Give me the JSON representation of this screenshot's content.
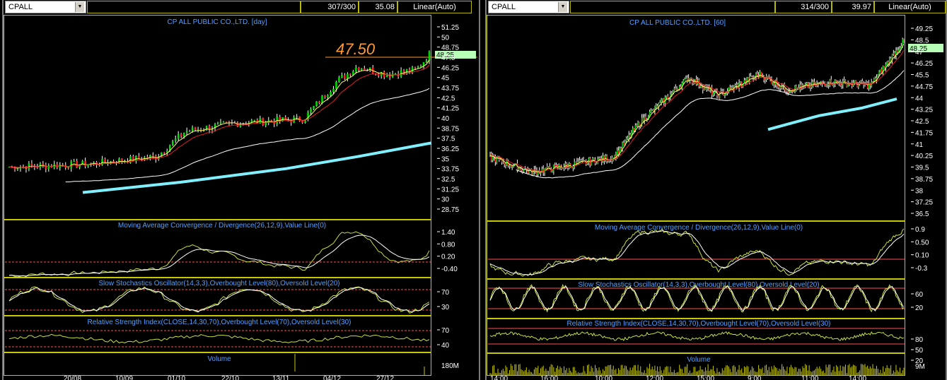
{
  "left": {
    "symbol": "CPALL",
    "counter": "307/300",
    "last_value": "35.08",
    "scale_mode": "Linear(Auto)",
    "title": "CP ALL PUBLIC CO.,LTD. [day]",
    "annotation": "47.50",
    "price_tag": "48.25",
    "price_ticks": [
      "51.25",
      "50",
      "48.75",
      "47.5",
      "46.25",
      "45",
      "43.75",
      "42.5",
      "41.25",
      "40",
      "38.75",
      "37.5",
      "36.25",
      "35",
      "33.75",
      "32.5",
      "31.25",
      "30",
      "28.75"
    ],
    "macd_title": "Moving Average Convergence / Divergence(26,12,9),Value Line(0)",
    "macd_ticks": [
      "1.40",
      "0.80",
      "0.20",
      "-0.40"
    ],
    "stoch_title": "Slow Stochastics Oscillator(14,3,3),Overbought Level(80),Oversold Level(20)",
    "stoch_ticks": [
      "70",
      "30"
    ],
    "rsi_title": "Relative Strength Index(CLOSE,14,30,70),Overbought Level(70),Oversold Level(30)",
    "rsi_ticks": [
      "70",
      "40"
    ],
    "volume_title": "Volume",
    "volume_tick": "180M",
    "date_labels": [
      "20/08",
      "10/09",
      "01/10",
      "22/10",
      "13/11",
      "04/12",
      "27/12"
    ]
  },
  "right": {
    "symbol": "CPALL",
    "counter": "314/300",
    "last_value": "39.97",
    "scale_mode": "Linear(Auto)",
    "title": "CP ALL PUBLIC CO.,LTD. [60]",
    "price_tag": "48.25",
    "price_ticks": [
      "49.25",
      "48.5",
      "47",
      "46.25",
      "45.5",
      "44.75",
      "44",
      "43.25",
      "42.5",
      "41.75",
      "41",
      "40.25",
      "39.5",
      "38.75",
      "38",
      "37.25",
      "36.5"
    ],
    "macd_title": "Moving Average Convergence / Divergence(26,12,9),Value Line(0)",
    "macd_ticks": [
      "0.9",
      "0.50",
      "0.10",
      "-0.3"
    ],
    "stoch_title": "Slow Stochastics Oscillator(14,3,3),Overbought Level(80),Oversold Level(20)",
    "stoch_ticks": [
      "60",
      "20"
    ],
    "rsi_title": "Relative Strength Index(CLOSE,14,30,70),Overbought Level(70),Oversold Level(30)",
    "rsi_ticks": [
      "80",
      "50",
      "20"
    ],
    "volume_title": "Volume",
    "volume_tick": "9M",
    "date_labels": [
      "14:00",
      "16:00",
      "10:00",
      "12:00",
      "15:00",
      "9:00",
      "11:00",
      "14:00"
    ]
  },
  "colors": {
    "up_candle": "#00e000",
    "down_candle": "#ff2020",
    "ma_fast": "#ffff60",
    "ma_mid": "#e02020",
    "ma_slow": "#ffffff",
    "ma_long": "#80f0ff",
    "indicator_line": "#c8e040",
    "level_line": "#ff5050",
    "panel_border": "#c8c800",
    "title_text": "#50a0ff",
    "annotation": "#ff9a30"
  },
  "chart_data": [
    {
      "type": "line",
      "title": "CP ALL PUBLIC CO.,LTD. [day]",
      "x": [
        "20/08",
        "10/09",
        "01/10",
        "22/10",
        "13/11",
        "04/12",
        "27/12"
      ],
      "series": [
        {
          "values": [
            34.6,
            34.9,
            35.8,
            39.2,
            39.9,
            44.9,
            45.9
          ]
        }
      ],
      "ylim": [
        28.75,
        51.25
      ],
      "annotation": "47.50",
      "last_price": 48.25
    },
    {
      "type": "line",
      "title": "CP ALL PUBLIC CO.,LTD. [60]",
      "x": [
        "14:00",
        "16:00",
        "10:00",
        "12:00",
        "15:00",
        "9:00",
        "11:00",
        "14:00"
      ],
      "series": [
        {
          "values": [
            40.6,
            39.3,
            40.1,
            42.9,
            45.8,
            45.4,
            45.1,
            45.2
          ]
        }
      ],
      "ylim": [
        36.5,
        49.25
      ],
      "last_price": 48.25
    }
  ]
}
